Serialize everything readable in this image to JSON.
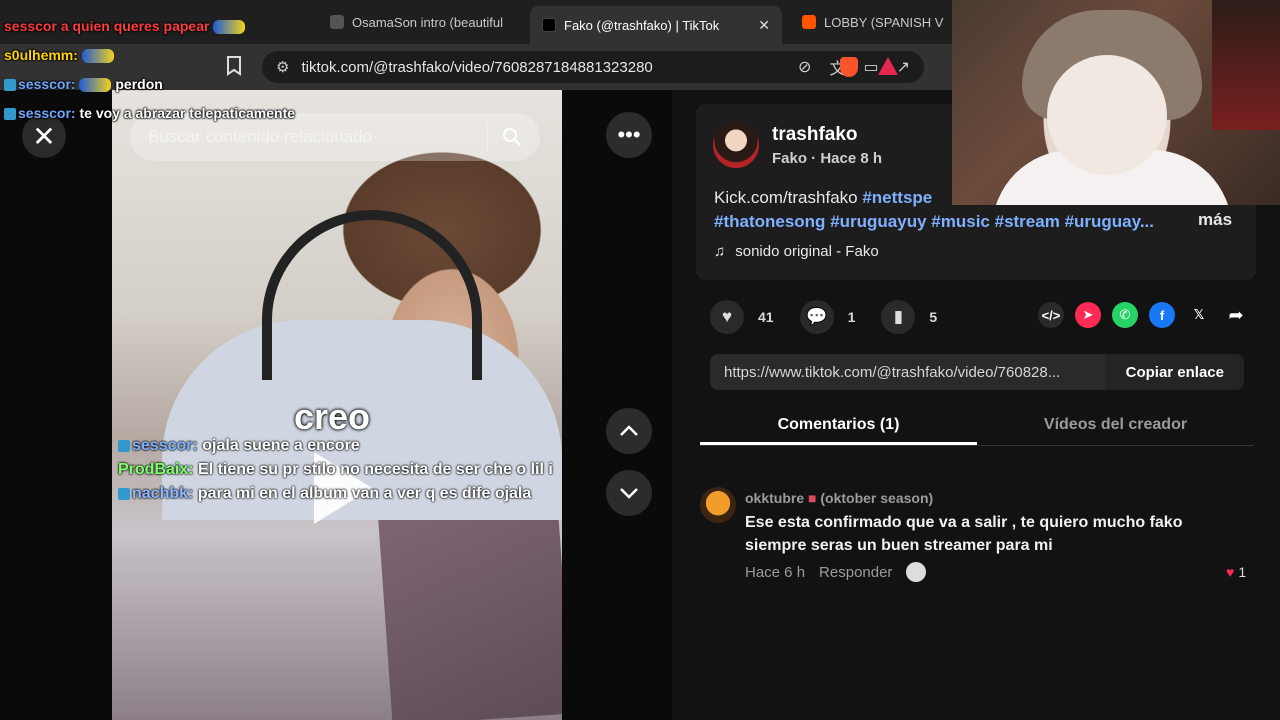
{
  "browser": {
    "tabs": [
      {
        "label": "OsamaSon intro (beautiful",
        "active": false
      },
      {
        "label": "Fako (@trashfako) | TikTok",
        "active": true
      },
      {
        "label": "LOBBY (SPANISH V",
        "active": false
      }
    ],
    "url": "tiktok.com/@trashfako/video/7608287184881323280",
    "close_tab": "✕"
  },
  "overlay_chat": [
    {
      "user": "sesscor",
      "text": "sesscor a quien queres papear"
    },
    {
      "user": "s0ulhemm:",
      "text": ""
    },
    {
      "user": "sesscor:",
      "text": "perdon"
    },
    {
      "user": "sesscor:",
      "text": "te voy a abrazar telepaticamente"
    }
  ],
  "video": {
    "search_placeholder": "Buscar contenido relacionado",
    "caption_word": "creo",
    "chat": [
      {
        "user": "sesscor:",
        "text": "ojala suene a encore"
      },
      {
        "user": "ProdBaix:",
        "text": "El tiene su pr",
        "rest": "stilo no necesita de ser che o lil i"
      },
      {
        "user": "nachbk:",
        "text": "para mi en el album van a ver q es dife",
        "rest": "ojala"
      }
    ]
  },
  "post": {
    "author": "trashfako",
    "author_sub": "Fako · Hace 8 h",
    "desc_prefix": "Kick.com/trashfako",
    "desc_tags_line1": "#nettspe",
    "desc_tags_line2": [
      "#thatonesong",
      "#uruguayuy",
      "#music",
      "#stream",
      "#uruguay..."
    ],
    "more": "más",
    "sound": "sonido original - Fako",
    "likes": "41",
    "comments": "1",
    "saves": "5",
    "link": "https://www.tiktok.com/@trashfako/video/760828...",
    "copy_label": "Copiar enlace",
    "tab_comments": "Comentarios (1)",
    "tab_creator": "Vídeos del creador"
  },
  "comment": {
    "user": "okktubre",
    "user_suffix": "(oktober season)",
    "text": "Ese esta confirmado que va a salir , te quiero mucho fako siempre seras un buen streamer para mi",
    "time": "Hace 6 h",
    "reply": "Responder",
    "likes": "1"
  },
  "colors": {
    "accent_tag": "#7fb0ff",
    "like_red": "#ff2b55",
    "whatsapp": "#25d366",
    "facebook": "#1877f2",
    "telegram_like": "#fe2c55"
  }
}
